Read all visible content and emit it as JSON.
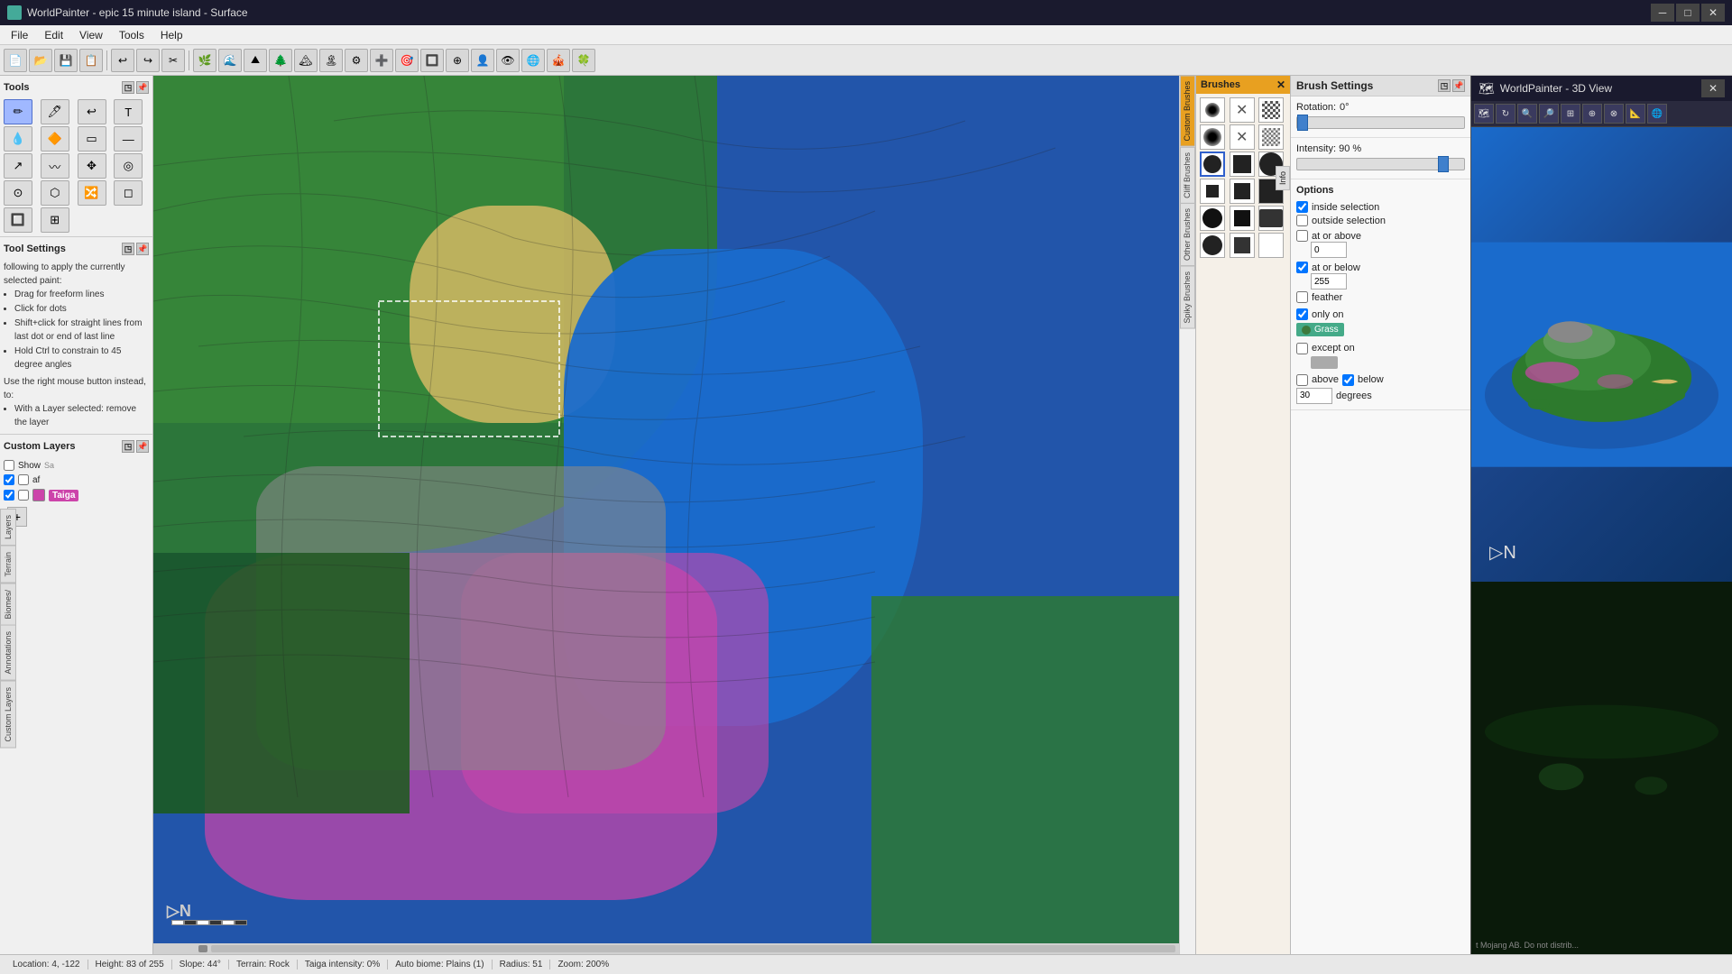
{
  "window": {
    "title": "WorldPainter - epic 15 minute island - Surface",
    "icon": "🗺️"
  },
  "window3d": {
    "title": "WorldPainter - 3D View"
  },
  "menu": {
    "items": [
      "File",
      "Edit",
      "View",
      "Tools",
      "Help"
    ]
  },
  "tools_panel": {
    "title": "Tools",
    "buttons": [
      {
        "icon": "✏️",
        "name": "brush-tool",
        "title": "Brush"
      },
      {
        "icon": "🖊",
        "name": "pencil-tool",
        "title": "Pencil"
      },
      {
        "icon": "↩",
        "name": "undo-tool",
        "title": "Undo"
      },
      {
        "icon": "T",
        "name": "text-tool",
        "title": "Text"
      },
      {
        "icon": "💧",
        "name": "water-tool",
        "title": "Water"
      },
      {
        "icon": "🔥",
        "name": "fire-tool",
        "title": "Fire"
      },
      {
        "icon": "▭",
        "name": "rect-tool",
        "title": "Rectangle"
      },
      {
        "icon": "—",
        "name": "line-tool",
        "title": "Line"
      },
      {
        "icon": "↗",
        "name": "arrow-tool",
        "title": "Arrow"
      },
      {
        "icon": "〰",
        "name": "curve-tool",
        "title": "Curve"
      },
      {
        "icon": "✥",
        "name": "move-tool",
        "title": "Move"
      },
      {
        "icon": "◎",
        "name": "circle-tool",
        "title": "Circle"
      },
      {
        "icon": "⊙",
        "name": "eye-tool",
        "title": "Eye"
      },
      {
        "icon": "⬡",
        "name": "hex-tool",
        "title": "Hexagon"
      },
      {
        "icon": "🔀",
        "name": "transform-tool",
        "title": "Transform"
      },
      {
        "icon": "◻",
        "name": "select-tool",
        "title": "Select"
      },
      {
        "icon": "🔲",
        "name": "box-tool",
        "title": "Box"
      },
      {
        "icon": "⊞",
        "name": "grid-tool",
        "title": "Grid"
      }
    ]
  },
  "tool_settings": {
    "title": "Tool Settings",
    "description": "following to apply the currently selected paint:",
    "tips": [
      "Drag for freeform lines",
      "Click for dots",
      "Shift+click for straight lines from last dot or end of last line",
      "Hold Ctrl to constrain to 45 degree angles"
    ],
    "right_mouse_note": "Use the right mouse button instead, to:",
    "right_mouse_tips": [
      "With a Layer selected: remove the layer"
    ]
  },
  "custom_layers": {
    "title": "Custom Layers",
    "layers": [
      {
        "name": "Show",
        "checked": false,
        "has_color": false,
        "color": null
      },
      {
        "name": "af",
        "checked": true,
        "has_color": false,
        "color": null
      },
      {
        "name": "Taiga",
        "checked": true,
        "has_color": true,
        "color": "#cc44aa"
      }
    ],
    "add_btn": "+"
  },
  "brushes": {
    "title": "Brushes",
    "categories": [
      "Custom Brushes",
      "Cliff Brushes",
      "Other Brushes",
      "Spiky Brushes"
    ],
    "brush_types": [
      "soft-round",
      "cross",
      "noise1",
      "soft-round2",
      "cross2",
      "noise2",
      "hard-round",
      "hard-square",
      "hard-circle-lg",
      "square-sm",
      "square-md",
      "square-lg",
      "round-soft",
      "square-dark",
      "pad",
      "spiky1"
    ]
  },
  "brush_settings": {
    "title": "Brush Settings",
    "rotation_label": "Rotation:",
    "rotation_value": "0°",
    "intensity_label": "Intensity: 90 %",
    "intensity_value": 90
  },
  "options": {
    "title": "Options",
    "inside_selection": {
      "label": "inside selection",
      "checked": true
    },
    "outside_selection": {
      "label": "outside selection",
      "checked": false
    },
    "at_or_above": {
      "label": "at or above",
      "checked": false
    },
    "at_or_above_value": "0",
    "at_or_below": {
      "label": "at or below",
      "checked": true
    },
    "at_or_below_value": "255",
    "feather": {
      "label": "feather",
      "checked": false
    },
    "only_on": {
      "label": "only on",
      "checked": true,
      "layer": "Grass"
    },
    "except_on": {
      "label": "except on",
      "checked": false
    },
    "above": {
      "label": "above",
      "checked": false
    },
    "below": {
      "label": "below",
      "checked": true
    },
    "degrees_value": "30",
    "degrees_label": "degrees"
  },
  "status_bar": {
    "location": "Location: 4, -122",
    "height": "Height: 83 of 255",
    "slope": "Slope: 44°",
    "terrain": "Terrain: Rock",
    "taiga_intensity": "Taiga intensity: 0%",
    "auto_biome": "Auto biome: Plains (1)",
    "radius": "Radius: 51",
    "zoom": "Zoom: 200%"
  },
  "vertical_tabs": {
    "left": [
      "Layers",
      "Terrain",
      "Biomes/",
      "Annotations",
      "Custom Layers"
    ],
    "brush": [
      "Custom Brushes",
      "Cliff Brushes",
      "Other Brushes",
      "Spiky Brushes"
    ]
  },
  "copyright": "t Mojang AB. Do not distrib..."
}
